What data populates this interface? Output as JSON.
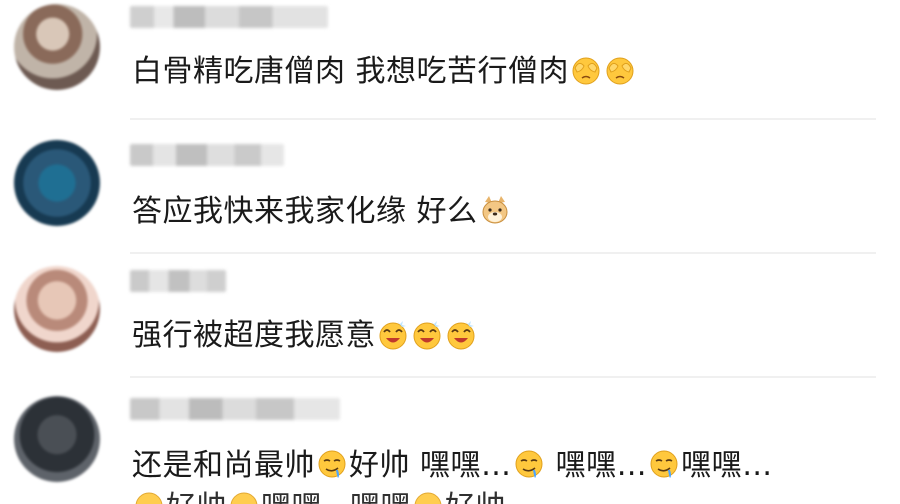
{
  "comments": [
    {
      "segments": [
        "白骨精吃唐僧肉 我想吃苦行僧肉"
      ],
      "emojis": [
        "shy-cover-face-emoji",
        "shy-cover-face-emoji"
      ]
    },
    {
      "segments": [
        "答应我快来我家化缘 好么"
      ],
      "emojis": [
        "doge-emoji"
      ]
    },
    {
      "segments": [
        "强行被超度我愿意"
      ],
      "emojis": [
        "star-struck-emoji",
        "star-struck-emoji",
        "star-struck-emoji"
      ]
    },
    {
      "segments": [
        "还是和尚最帅",
        "好帅 嘿嘿…",
        " 嘿嘿…",
        "嘿嘿…"
      ],
      "emojis": [
        "drooling-emoji",
        "drooling-emoji",
        "drooling-emoji"
      ],
      "overflow_segments": [
        "好帅",
        "嘿嘿",
        "嘿嘿",
        "好帅"
      ]
    }
  ],
  "colors": {
    "emoji_yellow": "#ffc83d",
    "emoji_outline": "#e0a01c",
    "drool_blue": "#4aa3ff",
    "divider": "#f0f0f0",
    "text": "#1a1a1a"
  }
}
